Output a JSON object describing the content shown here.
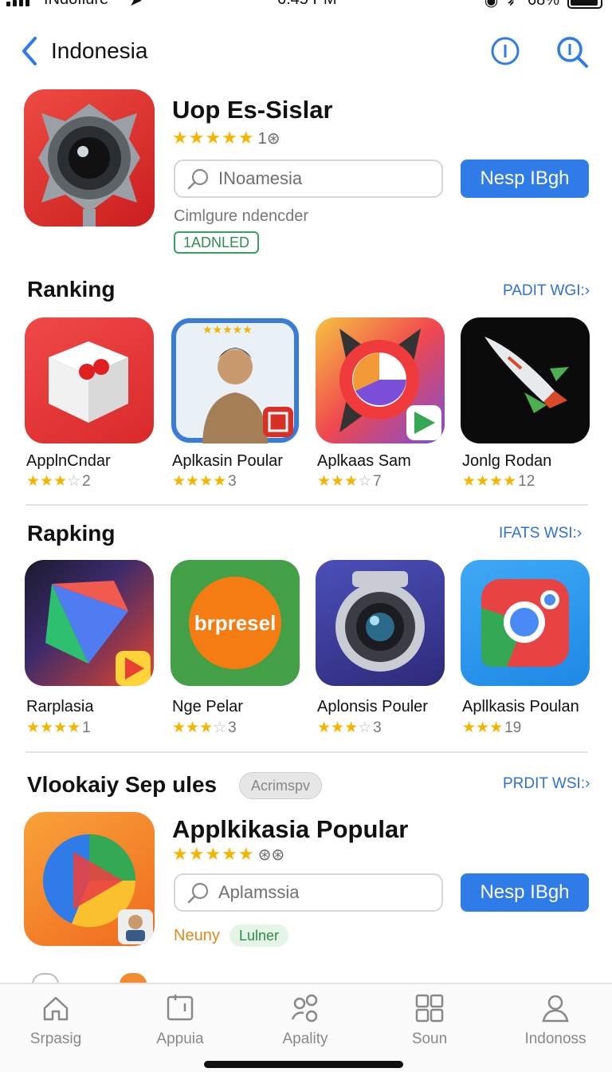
{
  "status_bar": {
    "carrier": "INdofiure",
    "time": "6:45 PM",
    "battery": "68%"
  },
  "nav": {
    "title": "Indonesia",
    "back_icon": "chevron-left-icon",
    "info_icon": "info-icon",
    "search_icon": "search-icon"
  },
  "featured": {
    "name": "Uop Es-Sislar",
    "stars": "★★★★★",
    "rating_count": "1⊛",
    "search_placeholder": "INoamesia",
    "button_label": "Nesp IBgh",
    "subtitle": "Cimlgure ndencder",
    "badge": "1ADNLED"
  },
  "section1": {
    "title": "Ranking",
    "see_all": "PADIT WGI:",
    "apps": [
      {
        "name": "ApplnCndar",
        "stars_on": "★★★",
        "stars_off": "☆",
        "count": "2"
      },
      {
        "name": "Aplkasin Poular",
        "stars_on": "★★★★",
        "stars_off": "",
        "count": "3"
      },
      {
        "name": "Aplkaas Sam",
        "stars_on": "★★★",
        "stars_off": "☆",
        "count": "7"
      },
      {
        "name": "Jonlg Rodan",
        "stars_on": "★★★★",
        "stars_off": "",
        "count": "12"
      }
    ]
  },
  "section2": {
    "title": "Rapking",
    "see_all": "IFATS WSI:",
    "apps": [
      {
        "name": "Rarplasia",
        "stars_on": "★★★★",
        "stars_off": "",
        "count": "1"
      },
      {
        "name": "Nge Pelar",
        "stars_on": "★★★",
        "stars_off": "☆",
        "count": "3",
        "icon_text": "brpresel"
      },
      {
        "name": "Aplonsis Pouler",
        "stars_on": "★★★",
        "stars_off": "☆",
        "count": "3"
      },
      {
        "name": "Apllkasis Poulan",
        "stars_on": "★★★",
        "stars_off": "",
        "count": "19"
      }
    ]
  },
  "section3": {
    "title": "Vlookaiy Sep ules",
    "pill": "Acrimspv",
    "see_all": "PRDIT WSI:",
    "featured": {
      "name": "Applkikasia Popular",
      "stars": "★★★★★",
      "rating_count": "⊛⊛",
      "search_placeholder": "Aplamssia",
      "button_label": "Nesp IBgh",
      "tag_orange": "Neuny",
      "tag_green": "Lulner"
    }
  },
  "tabs": [
    {
      "label": "Srpasig",
      "icon": "home-icon"
    },
    {
      "label": "Appuia",
      "icon": "apps-icon"
    },
    {
      "label": "Apality",
      "icon": "people-icon"
    },
    {
      "label": "Soun",
      "icon": "grid-icon"
    },
    {
      "label": "Indonoss",
      "icon": "person-icon"
    }
  ],
  "colors": {
    "accent": "#2f7be8",
    "link": "#2f6fd8",
    "star": "#f4b400",
    "badge_green": "#37a35c"
  }
}
